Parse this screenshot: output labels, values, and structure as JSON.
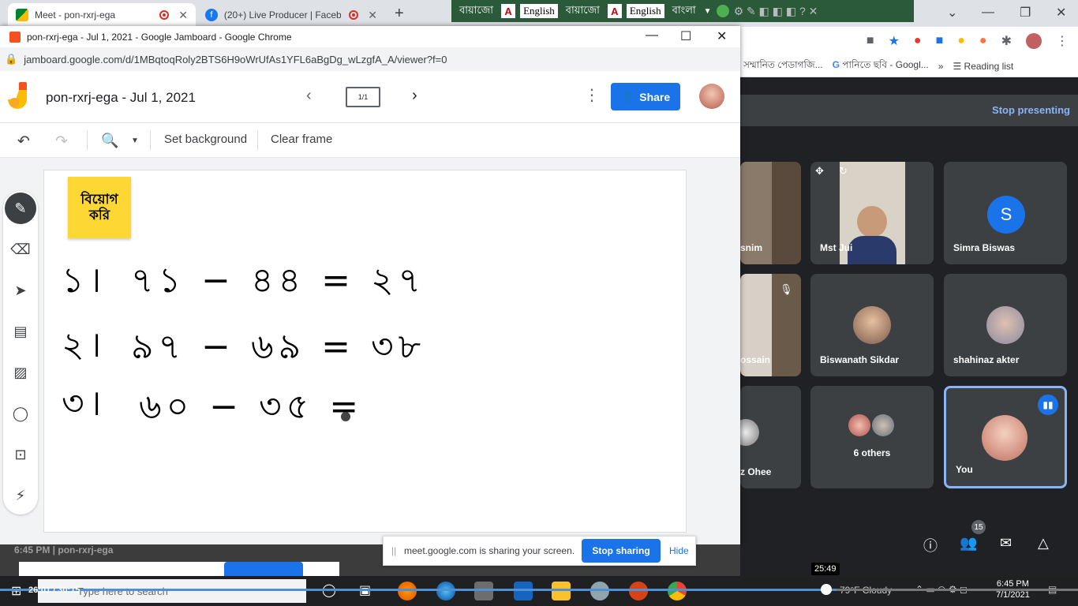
{
  "back_browser": {
    "tabs": [
      {
        "title": "Meet - pon-rxrj-ega"
      },
      {
        "title": "(20+) Live Producer | Faceb"
      }
    ],
    "lang_bar": {
      "items": [
        "বায়াজো",
        "English",
        "বায়াজো",
        "English",
        "বাংলা"
      ]
    },
    "bookmarks": [
      "সম্মানিত পেডাগজি...",
      "পানিতে ছবি - Googl...",
      "»",
      "Reading list"
    ]
  },
  "meet": {
    "stop_presenting": "Stop presenting",
    "participants": [
      {
        "name": "snim"
      },
      {
        "name": "Mst Jui"
      },
      {
        "name": "Simra Biswas",
        "initial": "S"
      },
      {
        "name": "ossain"
      },
      {
        "name": "Biswanath Sikdar"
      },
      {
        "name": "shahinaz akter"
      },
      {
        "name": "z Ohee"
      },
      {
        "name": "6 others"
      },
      {
        "name": "You"
      }
    ],
    "participant_count": "15",
    "time_tooltip": "25:49"
  },
  "front_window": {
    "title": "pon-rxrj-ega - Jul 1, 2021 - Google Jamboard - Google Chrome",
    "url": "jamboard.google.com/d/1MBqtoqRoly2BTS6H9oWrUfAs1YFL6aBgDg_wLzgfA_A/viewer?f=0"
  },
  "jamboard": {
    "doc_title": "pon-rxrj-ega - Jul 1, 2021",
    "frame_indicator": "1/1",
    "share_label": "Share",
    "toolbar": {
      "set_background": "Set background",
      "clear_frame": "Clear frame"
    },
    "sticky_note": {
      "line1": "বিয়োগ",
      "line2": "করি"
    },
    "handwriting": [
      {
        "number": "১।",
        "expr": "৭১ − ৪৪ = ২৭"
      },
      {
        "number": "২।",
        "expr": "৯৭ − ৬৯ = ৩৮"
      },
      {
        "number": "৩।",
        "expr": "৬০ − ৩৫ ="
      }
    ]
  },
  "share_notice": {
    "message": "meet.google.com is sharing your screen.",
    "stop_sharing": "Stop sharing",
    "hide": "Hide"
  },
  "under_strip": {
    "text": "6:45 PM | pon-rxrj-ega"
  },
  "taskbar": {
    "search_placeholder": "Type here to search",
    "video_time": "26:01 / 30:15",
    "weather": "79°F Cloudy",
    "clock_time": "6:45 PM",
    "clock_date": "7/1/2021"
  },
  "colors": {
    "accent": "#1a73e8",
    "sticky": "#fdd835",
    "meet_bg": "#202124",
    "tile_bg": "#3c4043",
    "link": "#8ab4f8"
  }
}
